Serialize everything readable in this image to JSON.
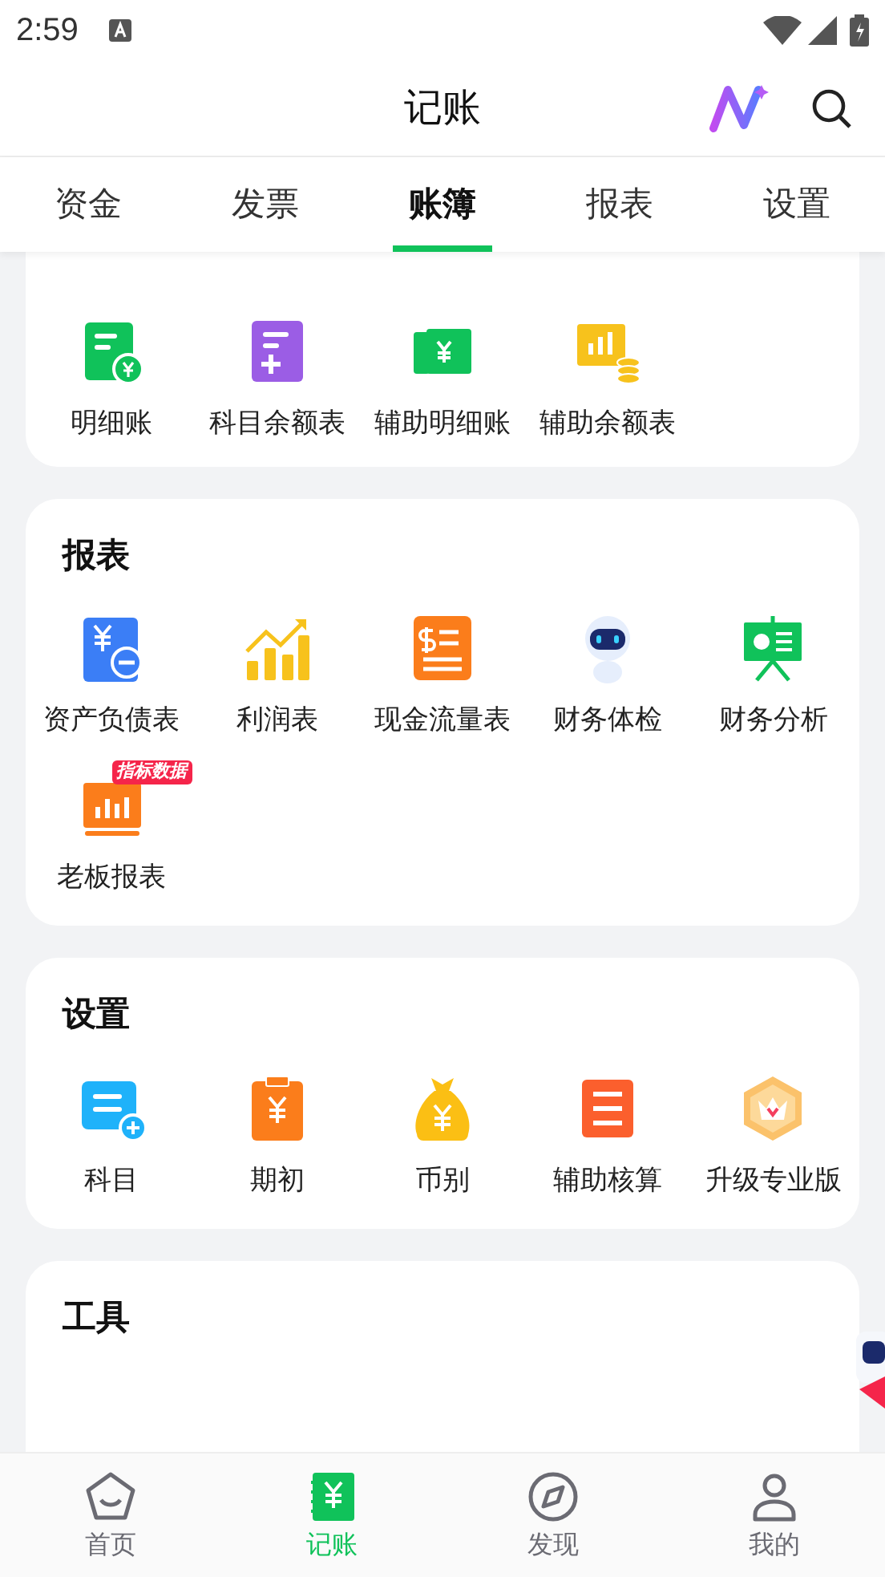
{
  "status_bar": {
    "time": "2:59"
  },
  "header": {
    "title": "记账"
  },
  "tabs": [
    {
      "label": "资金",
      "selected": false
    },
    {
      "label": "发票",
      "selected": false
    },
    {
      "label": "账簿",
      "selected": true
    },
    {
      "label": "报表",
      "selected": false
    },
    {
      "label": "设置",
      "selected": false
    }
  ],
  "sections": [
    {
      "items": [
        {
          "label": "明细账"
        },
        {
          "label": "科目余额表"
        },
        {
          "label": "辅助明细账"
        },
        {
          "label": "辅助余额表"
        }
      ]
    },
    {
      "title": "报表",
      "items": [
        {
          "label": "资产负债表"
        },
        {
          "label": "利润表"
        },
        {
          "label": "现金流量表"
        },
        {
          "label": "财务体检"
        },
        {
          "label": "财务分析"
        },
        {
          "label": "老板报表",
          "badge": "指标数据"
        }
      ]
    },
    {
      "title": "设置",
      "items": [
        {
          "label": "科目"
        },
        {
          "label": "期初"
        },
        {
          "label": "币别"
        },
        {
          "label": "辅助核算"
        },
        {
          "label": "升级专业版"
        }
      ]
    },
    {
      "title": "工具"
    }
  ],
  "bottom_nav": [
    {
      "label": "首页",
      "selected": false
    },
    {
      "label": "记账",
      "selected": true
    },
    {
      "label": "发现",
      "selected": false
    },
    {
      "label": "我的",
      "selected": false
    }
  ]
}
